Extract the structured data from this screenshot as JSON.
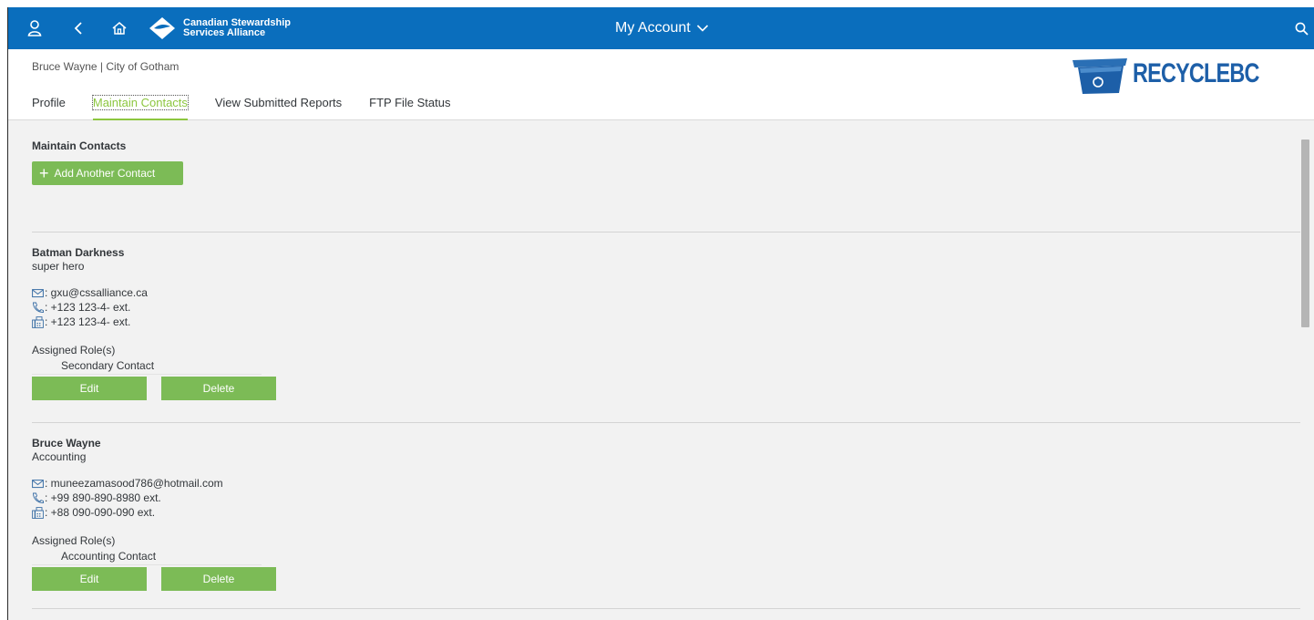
{
  "topbar": {
    "org_line1": "Canadian Stewardship",
    "org_line2": "Services Alliance",
    "title": "My Account"
  },
  "header": {
    "user_line": "Bruce Wayne | City of Gotham",
    "brand_recycle": "RECYCLE",
    "brand_bc": "BC",
    "tabs": [
      {
        "label": "Profile"
      },
      {
        "label": "Maintain Contacts"
      },
      {
        "label": "View Submitted Reports"
      },
      {
        "label": "FTP File Status"
      }
    ]
  },
  "main": {
    "section_title": "Maintain Contacts",
    "add_label": "Add Another Contact",
    "contacts": [
      {
        "name": "Batman Darkness",
        "dept": "super hero",
        "email": ": gxu@cssalliance.ca",
        "phone": ": +123 123-4- ext.",
        "fax": ": +123 123-4- ext.",
        "roles_label": "Assigned Role(s)",
        "role": "Secondary Contact",
        "edit_label": "Edit",
        "delete_label": "Delete"
      },
      {
        "name": "Bruce Wayne",
        "dept": "Accounting",
        "email": ": muneezamasood786@hotmail.com",
        "phone": ": +99 890-890-8980 ext.",
        "fax": ": +88 090-090-090 ext.",
        "roles_label": "Assigned Role(s)",
        "role": "Accounting Contact",
        "edit_label": "Edit",
        "delete_label": "Delete"
      }
    ]
  },
  "colors": {
    "topbar": "#0a6ebd",
    "accent_green": "#7cbb56",
    "tab_active": "#8cc63f",
    "brand_blue": "#1d5fa8"
  }
}
